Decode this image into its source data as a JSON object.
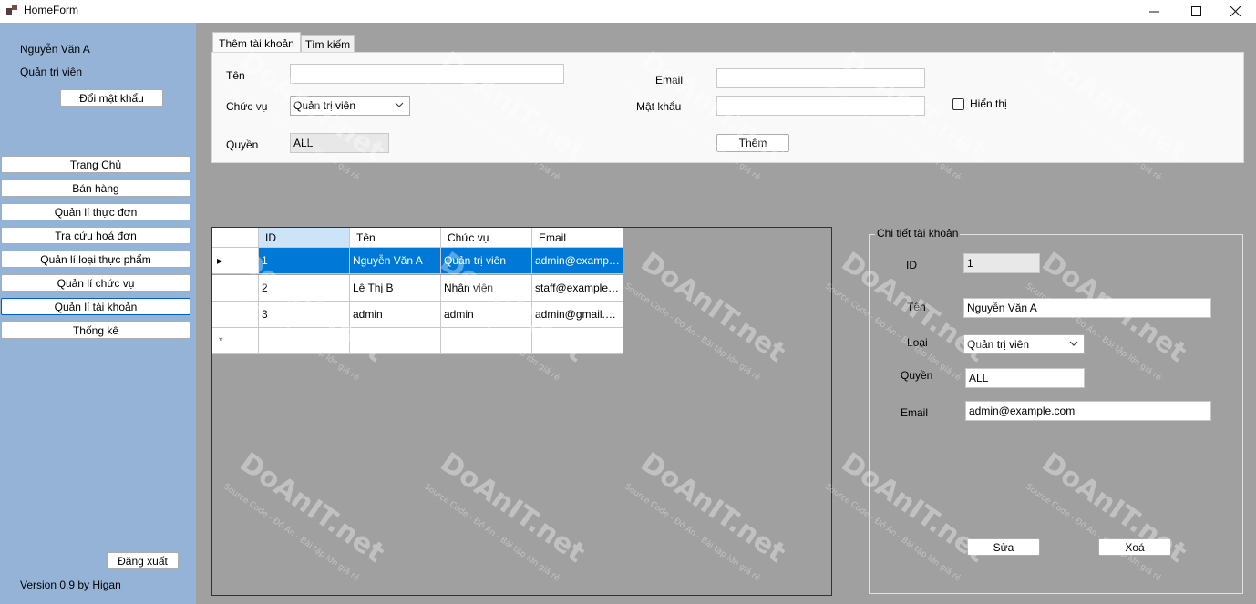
{
  "window": {
    "title": "HomeForm",
    "minimize": "—",
    "maximize": "☐",
    "close": "✕"
  },
  "sidebar": {
    "user_name": "Nguyễn Văn A",
    "user_role": "Quản trị viên",
    "change_password": "Đổi mật khẩu",
    "nav": [
      "Trang Chủ",
      "Bán hàng",
      "Quản lí thực đơn",
      "Tra cứu hoá đơn",
      "Quản lí loại thực phẩm",
      "Quản lí chức vụ",
      "Quản lí tài khoản",
      "Thống kê"
    ],
    "active_index": 6,
    "logout": "Đăng xuất",
    "version": "Version 0.9 by Higan"
  },
  "tabs": [
    "Thêm tài khoản",
    "Tìm kiếm"
  ],
  "add_form": {
    "name_label": "Tên",
    "name_value": "",
    "role_label": "Chức vụ",
    "role_value": "Quản trị viên",
    "permission_label": "Quyền",
    "permission_value": "ALL",
    "email_label": "Email",
    "email_value": "",
    "password_label": "Mật khẩu",
    "password_value": "",
    "show_label": "Hiển thị",
    "show_checked": false,
    "add_button": "Thêm"
  },
  "grid": {
    "columns": [
      "ID",
      "Tên",
      "Chức vụ",
      "Email"
    ],
    "rows": [
      [
        "1",
        "Nguyễn Văn A",
        "Quản trị viên",
        "admin@example.com"
      ],
      [
        "2",
        "Lê Thị B",
        "Nhân viên",
        "staff@example.com"
      ],
      [
        "3",
        "admin",
        "admin",
        "admin@gmail.com"
      ]
    ],
    "selected_row": 0,
    "current_marker": "▸",
    "new_row_marker": "*"
  },
  "detail": {
    "title": "Chi tiết tài khoản",
    "id_label": "ID",
    "id_value": "1",
    "name_label": "Tên",
    "name_value": "Nguyễn Văn A",
    "type_label": "Loại",
    "type_value": "Quản trị viên",
    "permission_label": "Quyền",
    "permission_value": "ALL",
    "email_label": "Email",
    "email_value": "admin@example.com",
    "edit_button": "Sửa",
    "delete_button": "Xoá"
  },
  "watermark": {
    "brand": "DoAnIT.net",
    "tagline": "Source Code - Đồ Án - Bài tập lớn giá rẻ"
  }
}
